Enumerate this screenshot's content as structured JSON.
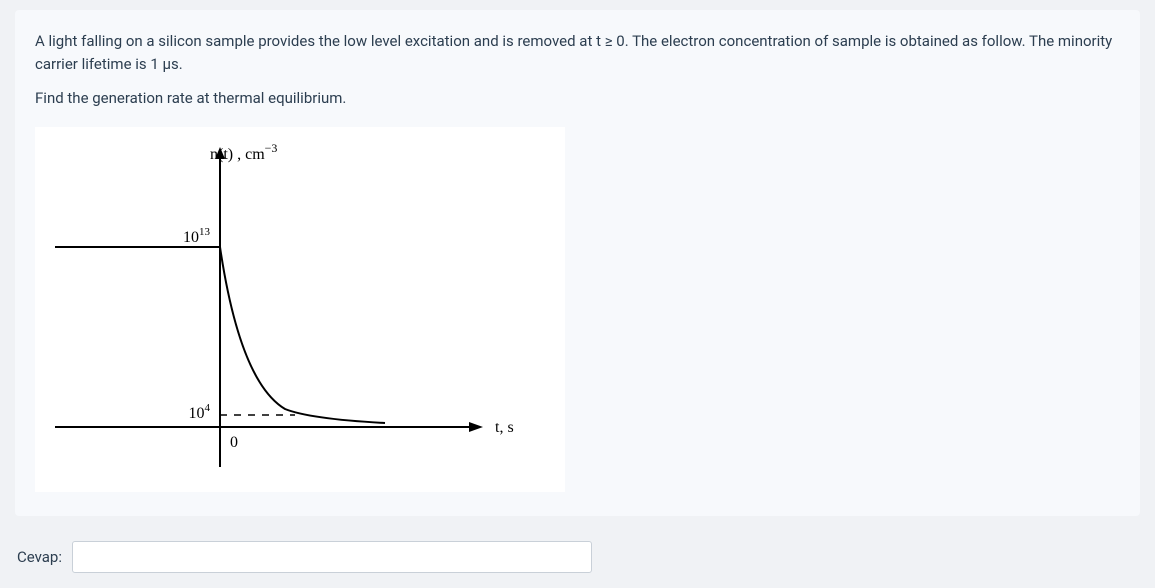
{
  "question": {
    "paragraph1": "A light falling on a silicon sample provides the low level excitation and is removed at t  ≥ 0. The electron concentration of sample is obtained as follow. The minority carrier lifetime is 1 µs.",
    "paragraph2": "Find the generation rate at thermal equilibrium."
  },
  "answer": {
    "label": "Cevap:",
    "value": ""
  },
  "chart_data": {
    "type": "line",
    "title": "",
    "y_axis_label": "n(t) , cm⁻³",
    "x_axis_label": "t, s",
    "y_ticks": [
      "10¹³",
      "10⁴"
    ],
    "x_ticks": [
      "0"
    ],
    "description": "Exponential decay curve of electron concentration n(t) starting from 10^13 cm^-3 at t=0 and asymptotically approaching 10^4 cm^-3 as t increases. For t<0 the value is constant at 10^13.",
    "series": [
      {
        "name": "n(t)",
        "initial_value": 10000000000000.0,
        "final_value": 10000.0,
        "behavior": "constant at 10^13 for t<0, exponential decay to 10^4 asymptote for t>=0"
      }
    ]
  }
}
